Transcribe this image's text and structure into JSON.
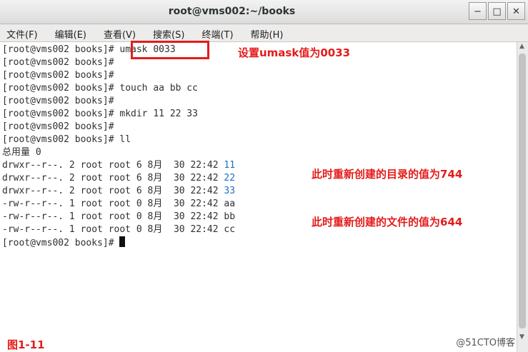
{
  "window": {
    "title": "root@vms002:~/books",
    "minimize": "−",
    "maximize": "□",
    "close": "✕"
  },
  "menu": [
    {
      "label": "文件(F)"
    },
    {
      "label": "编辑(E)"
    },
    {
      "label": "查看(V)"
    },
    {
      "label": "搜索(S)"
    },
    {
      "label": "终端(T)"
    },
    {
      "label": "帮助(H)"
    }
  ],
  "terminal": {
    "lines": [
      {
        "prompt": "[root@vms002 books]# ",
        "text": "umask 0033"
      },
      {
        "prompt": "[root@vms002 books]# ",
        "text": ""
      },
      {
        "prompt": "[root@vms002 books]# ",
        "text": ""
      },
      {
        "prompt": "[root@vms002 books]# ",
        "text": "touch aa bb cc"
      },
      {
        "prompt": "[root@vms002 books]# ",
        "text": ""
      },
      {
        "prompt": "[root@vms002 books]# ",
        "text": "mkdir 11 22 33"
      },
      {
        "prompt": "[root@vms002 books]# ",
        "text": ""
      },
      {
        "prompt": "[root@vms002 books]# ",
        "text": "ll"
      },
      {
        "prompt": "",
        "text": "总用量 0"
      },
      {
        "prompt": "",
        "text": "drwxr--r--. 2 root root 6 8月  30 22:42 ",
        "name": "11",
        "dir": true
      },
      {
        "prompt": "",
        "text": "drwxr--r--. 2 root root 6 8月  30 22:42 ",
        "name": "22",
        "dir": true
      },
      {
        "prompt": "",
        "text": "drwxr--r--. 2 root root 6 8月  30 22:42 ",
        "name": "33",
        "dir": true
      },
      {
        "prompt": "",
        "text": "-rw-r--r--. 1 root root 0 8月  30 22:42 ",
        "name": "aa",
        "dir": false
      },
      {
        "prompt": "",
        "text": "-rw-r--r--. 1 root root 0 8月  30 22:42 ",
        "name": "bb",
        "dir": false
      },
      {
        "prompt": "",
        "text": "-rw-r--r--. 1 root root 0 8月  30 22:42 ",
        "name": "cc",
        "dir": false
      },
      {
        "prompt": "[root@vms002 books]# ",
        "text": "",
        "cursor": true
      }
    ]
  },
  "annotations": {
    "umask_note": "设置umask值为0033",
    "dir_note": "此时重新创建的目录的值为744",
    "file_note": "此时重新创建的文件的值为644",
    "figure_label": "图1-11",
    "watermark": "@51CTO博客"
  },
  "colors": {
    "annotation": "#e51b1b",
    "directory": "#1f6fbf"
  }
}
